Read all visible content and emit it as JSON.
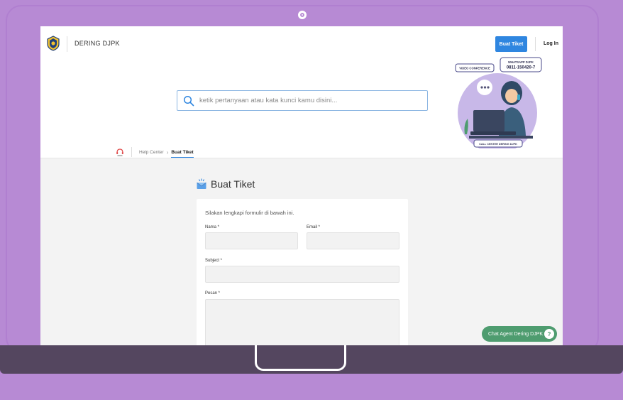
{
  "header": {
    "brand": "DERING DJPK",
    "ticket_button": "Buat Tiket",
    "login": "Log In"
  },
  "search": {
    "placeholder": "ketik pertanyaan atau kata kunci kamu disini..."
  },
  "illustration": {
    "video_badge": "VIDEO CONFERENCE",
    "whatsapp_title": "WHATSAPP DJPK",
    "whatsapp_number": "0811-150420-7",
    "call_center": "CALL CENTER DERING DJPK"
  },
  "breadcrumb": {
    "home": "Help Center",
    "current": "Buat Tiket"
  },
  "form": {
    "title": "Buat Tiket",
    "intro": "Silakan lengkapi formulir di bawah ini.",
    "name_label": "Nama *",
    "email_label": "Email *",
    "subject_label": "Subject *",
    "message_label": "Pesan *",
    "name_value": "",
    "email_value": "",
    "subject_value": "",
    "message_value": ""
  },
  "chat": {
    "label": "Chat Agent Dering DJPK",
    "icon": "?"
  },
  "colors": {
    "frame": "#b78ad4",
    "base": "#54465f",
    "primary": "#2f86e0",
    "chat": "#4e9c6f"
  }
}
